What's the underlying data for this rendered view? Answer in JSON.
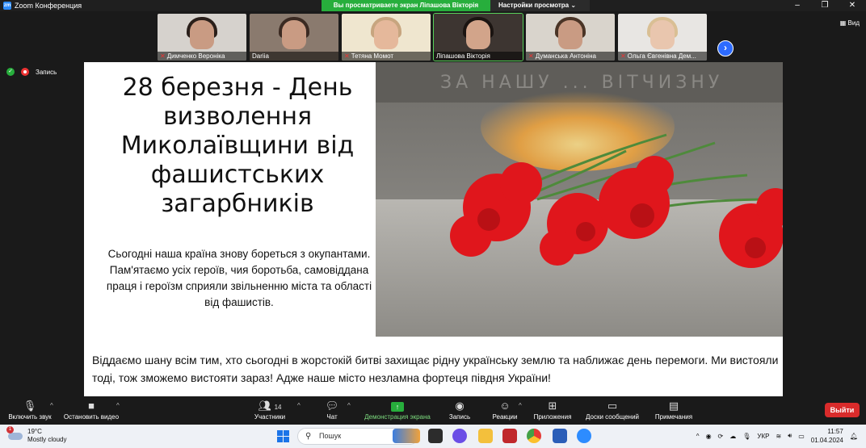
{
  "titlebar": {
    "app_title": "Zoom Конференция",
    "share_banner": "Вы просматриваете экран Ліпашова Вікторія",
    "view_options": "Настройки просмотра",
    "view_options_caret": "⌄"
  },
  "participants": [
    {
      "name": "Димченко Вероніка",
      "muted": true
    },
    {
      "name": "Dariia",
      "muted": false
    },
    {
      "name": "Тетяна Момот",
      "muted": true
    },
    {
      "name": "Ліпашова Вікторія",
      "muted": false
    },
    {
      "name": "Думанська Антоніна",
      "muted": true
    },
    {
      "name": "Ольга Євгенівна Дем...",
      "muted": true
    }
  ],
  "view_button": "Вид",
  "recording_label": "Запись",
  "slide": {
    "title": "28 березня - День визволення Миколаївщини від фашистських загарбників",
    "body": "Сьогодні наша країна знову бореться з окупантами. Пам'ятаємо усіх героїв, чия боротьба, самовіддана праця і героїзм сприяли звільненню міста та області від фашистів.",
    "memorial_text": "ЗА НАШУ ... ВІТЧИЗНУ",
    "footer": "Віддаємо шану всім тим, хто сьогодні в жорстокій битві захищає рідну українську землю та наближає день перемоги. Ми вистояли тоді, тож зможемо вистояти зараз! Адже наше місто незламна фортеця півдня України!"
  },
  "toolbar": {
    "mute": "Включить звук",
    "video": "Остановить видео",
    "participants": "Участники",
    "participants_count": "14",
    "chat": "Чат",
    "share": "Демонстрация экрана",
    "record": "Запись",
    "reactions": "Реакции",
    "apps": "Приложения",
    "whiteboards": "Доски сообщений",
    "notes": "Примечания",
    "leave": "Выйти"
  },
  "taskbar": {
    "temperature": "19°C",
    "weather": "Mostly cloudy",
    "weather_badge": "1",
    "search_placeholder": "Пошук",
    "language": "УКР",
    "time": "11:57",
    "date": "01.04.2024"
  },
  "colors": {
    "zoom_blue": "#2d8cff",
    "share_green": "#27ae3c",
    "leave_red": "#d92b2b",
    "carnation_red": "#e0161c"
  }
}
